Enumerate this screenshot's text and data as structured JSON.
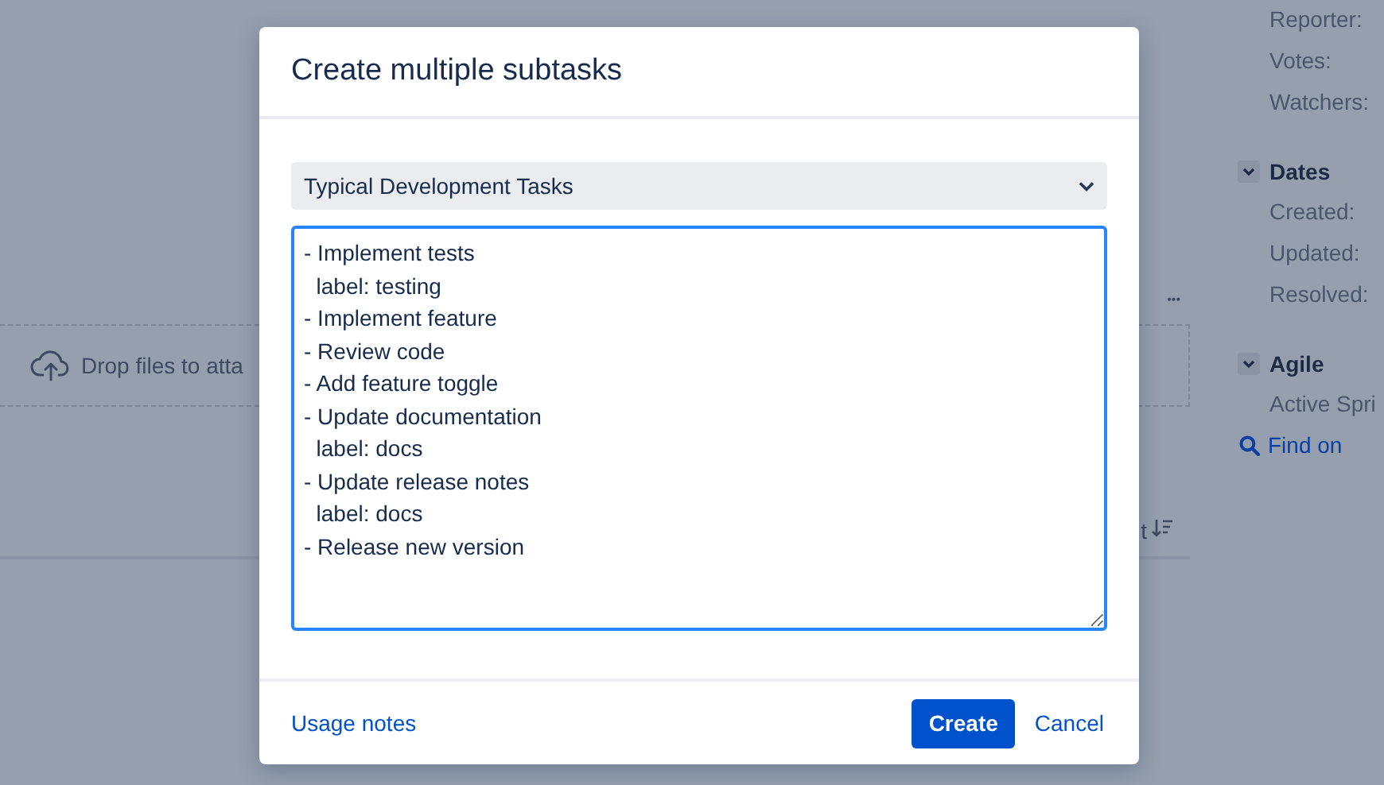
{
  "background": {
    "more_button": "•••",
    "dropzone": {
      "text": "Drop files to atta"
    },
    "sort": {
      "label": "t"
    },
    "sidebar": {
      "people_fields": [
        "Reporter:",
        "Votes:",
        "Watchers:"
      ],
      "sections": [
        {
          "title": "Dates",
          "expanded": true,
          "fields": [
            "Created:",
            "Updated:",
            "Resolved:"
          ]
        },
        {
          "title": "Agile",
          "expanded": true,
          "fields": [
            "Active Spri"
          ],
          "link": "Find on"
        }
      ]
    }
  },
  "dialog": {
    "title": "Create multiple subtasks",
    "template_select": {
      "value": "Typical Development Tasks"
    },
    "tasks_text": "- Implement tests\n  label: testing\n- Implement feature\n- Review code\n- Add feature toggle\n- Update documentation\n  label: docs\n- Update release notes\n  label: docs\n- Release new version",
    "footer": {
      "link": "Usage notes",
      "primary_button": "Create",
      "cancel_button": "Cancel"
    }
  }
}
